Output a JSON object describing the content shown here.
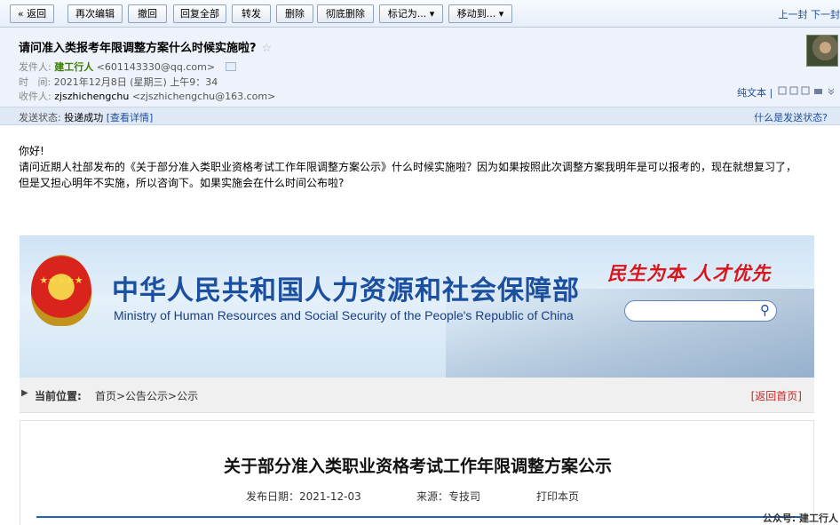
{
  "toolbar": {
    "buttons": [
      "« 返回",
      "再次编辑",
      "撤回",
      "回复全部",
      "转发",
      "删除",
      "彻底删除",
      "标记为... ▾",
      "移动到... ▾"
    ],
    "nav": "上一封 下一封"
  },
  "email": {
    "subject": "请问准入类报考年限调整方案什么时候实施啦?",
    "star": "☆",
    "from_label": "发件人:",
    "from_name": "建工行人",
    "from_addr": "<601143330@qq.com>",
    "time_label": "时   间:",
    "time_value": "2021年12月8日 (星期三) 上午9：34",
    "to_label": "收件人:",
    "to_name": "zjszhichengchu",
    "to_addr": "<zjszhichengchu@163.com>",
    "plain_text": "纯文本 |",
    "status_label": "发送状态:",
    "status_value": "投递成功",
    "status_link": "[查看详情]",
    "status_help": "什么是发送状态?"
  },
  "body": {
    "greeting": "你好!",
    "line1": "请问近期人社部发布的《关于部分准入类职业资格考试工作年限调整方案公示》什么时候实施啦？因为如果按照此次调整方案我明年是可以报考的，现在就想复习了，",
    "line2": "但是又担心明年不实施，所以咨询下。如果实施会在什么时间公布啦?"
  },
  "webpage": {
    "title_cn": "中华人民共和国人力资源和社会保障部",
    "title_en": "Ministry of Human Resources and Social Security of the People's Republic of China",
    "slogan": "民生为本  人才优先",
    "crumb_label": "当前位置:",
    "crumb_path": "首页>公告公示>公示",
    "back_home": "[返回首页]",
    "article_title": "关于部分准入类职业资格考试工作年限调整方案公示",
    "publish_date": "发布日期：2021-12-03",
    "source": "来源：专技司",
    "print": "打印本页"
  },
  "watermark": "公众号: 建工行人"
}
